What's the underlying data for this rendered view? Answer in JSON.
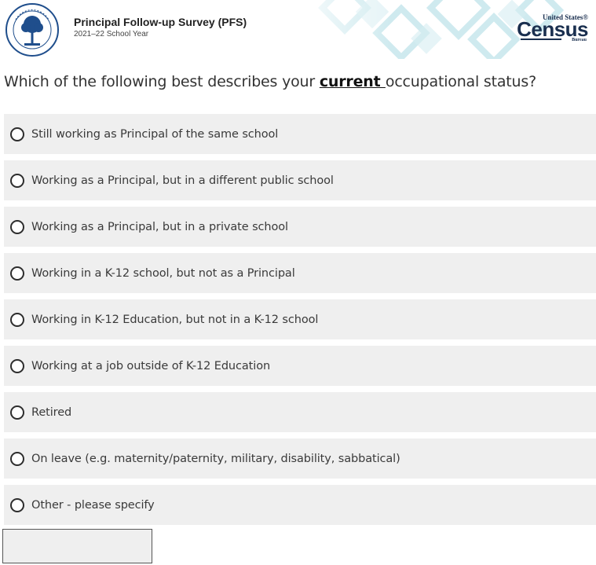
{
  "header": {
    "survey_title": "Principal Follow-up Survey (PFS)",
    "school_year": "2021–22 School Year",
    "seal_icon": "us-department-of-education-seal-icon",
    "logo": {
      "united_states": "United States®",
      "census": "Census",
      "bureau": "Bureau"
    }
  },
  "question": {
    "prefix": "Which of the following best describes your ",
    "emphasis": "current ",
    "suffix": "occupational status?"
  },
  "options": [
    {
      "label": "Still working as Principal of the same school",
      "selected": false
    },
    {
      "label": "Working as a Principal, but in a different public school",
      "selected": false
    },
    {
      "label": "Working as a Principal, but in a private school",
      "selected": false
    },
    {
      "label": "Working in a K-12 school, but not as a Principal",
      "selected": false
    },
    {
      "label": "Working in K-12 Education, but not in a K-12 school",
      "selected": false
    },
    {
      "label": "Working at a job outside of K-12 Education",
      "selected": false
    },
    {
      "label": "Retired",
      "selected": false
    },
    {
      "label": "On leave (e.g. maternity/paternity, military, disability, sabbatical)",
      "selected": false
    },
    {
      "label": "Other - please specify",
      "selected": false
    }
  ],
  "specify_input": {
    "value": ""
  },
  "colors": {
    "option_background": "#efefef",
    "census_navy": "#1a2f4f",
    "pattern_teal": "#bfe3ea"
  }
}
